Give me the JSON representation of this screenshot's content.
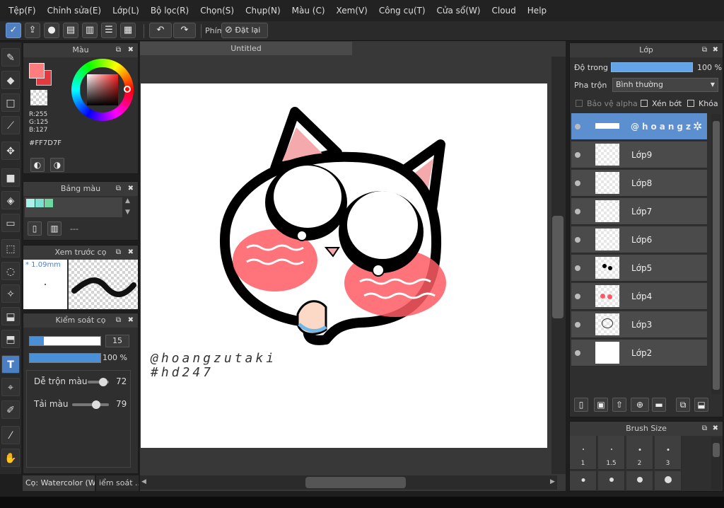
{
  "menu": [
    "Tệp(F)",
    "Chỉnh sửa(E)",
    "Lớp(L)",
    "Bộ lọc(R)",
    "Chọn(S)",
    "Chụp(N)",
    "Màu (C)",
    "Xem(V)",
    "Công cụ(T)",
    "Cửa sổ(W)",
    "Cloud",
    "Help"
  ],
  "toolbar": {
    "hotkey_label": "Phím",
    "reset_label": "Đặt lại"
  },
  "color_panel": {
    "title": "Màu",
    "r": "R:255",
    "g": "G:125",
    "b": "B:127",
    "hex": "#FF7D7F",
    "main_color": "#FF7D7F"
  },
  "palette_panel": {
    "title": "Bảng màu",
    "swatches": [
      "#a8f0e8",
      "#7fe0d0",
      "#6fd8a0"
    ],
    "name": "---"
  },
  "brush_preview": {
    "title": "Xem trước cọ",
    "size": "* 1.09mm"
  },
  "brush_control": {
    "title": "Kiểm soát cọ",
    "size_value": "15",
    "opacity_value": "100 %",
    "size_fill": 0.2,
    "opacity_fill": 1.0,
    "blend_label": "Dễ trộn màu",
    "blend_value": "72",
    "load_label": "Tải màu",
    "load_value": "79"
  },
  "bottom_tabs": {
    "tab1": "Cọ: Watercolor (W...",
    "tab2": "iểm soát ..."
  },
  "document": {
    "tab_title": "Untitled",
    "watermark_line1": "@hoangzutaki",
    "watermark_line2": "#hd247"
  },
  "layer_panel": {
    "title": "Lớp",
    "opacity_label": "Độ trong",
    "opacity_value": "100 %",
    "blend_label": "Pha trộn",
    "blend_mode": "Bình thường",
    "protect_alpha": "Bảo vệ alpha",
    "clipping": "Xén bớt",
    "lock": "Khóa",
    "layers": [
      "@hoangz",
      "Lớp9",
      "Lớp8",
      "Lớp7",
      "Lớp6",
      "Lớp5",
      "Lớp4",
      "Lớp3",
      "Lớp2"
    ]
  },
  "brush_size_panel": {
    "title": "Brush Size",
    "labels": [
      "1",
      "1.5",
      "2",
      "3"
    ]
  }
}
